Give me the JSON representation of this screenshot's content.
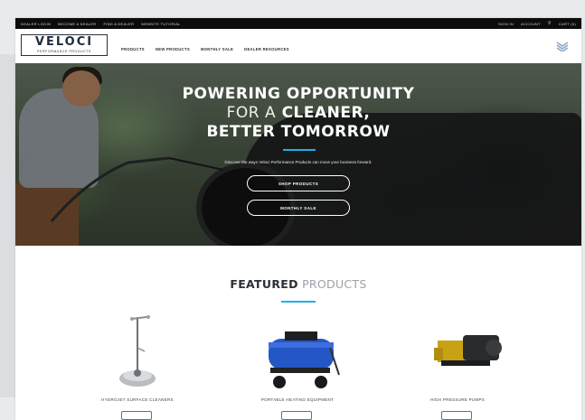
{
  "topbar": {
    "links": [
      "DEALER LOGIN",
      "BECOME A DEALER",
      "FIND A DEALER",
      "WEBSITE TUTORIAL"
    ],
    "right_links": [
      "SIGN IN",
      "ACCOUNT"
    ],
    "search_icon": "search-icon",
    "cart": "CART (0)"
  },
  "logo": {
    "name": "VELOCI",
    "tagline": "PERFORMANCE PRODUCTS"
  },
  "nav": {
    "items": [
      "PRODUCTS",
      "NEW PRODUCTS",
      "MONTHLY SALE",
      "DEALER RESOURCES"
    ]
  },
  "hero": {
    "line1": "POWERING OPPORTUNITY",
    "line2_thin": "FOR A",
    "line2_bold": "CLEANER,",
    "line3": "BETTER TOMORROW",
    "subtitle": "Discover the ways Veloci Performance Products can move your business forward.",
    "button1": "SHOP PRODUCTS",
    "button2": "MONTHLY SALE",
    "accent_color": "#19b4e6"
  },
  "featured": {
    "title_bold": "FEATURED",
    "title_light": "PRODUCTS",
    "products": [
      {
        "label": "HYDROJET SURFACE CLEANERS"
      },
      {
        "label": "PORTABLE HEATING EQUIPMENT"
      },
      {
        "label": "HIGH PRESSURE PUMPS"
      }
    ]
  }
}
